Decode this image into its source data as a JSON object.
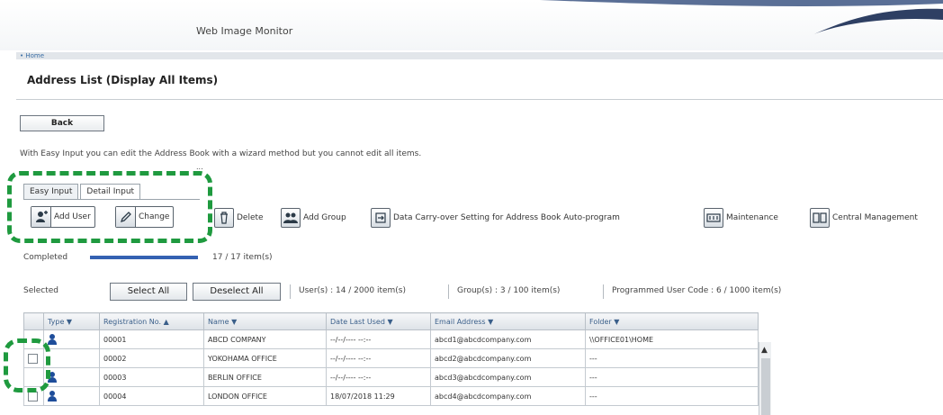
{
  "app": {
    "title": "Web Image Monitor"
  },
  "nav": {
    "home_link": "• Home"
  },
  "page": {
    "title": "Address List (Display All Items)"
  },
  "back_button": {
    "label": "Back"
  },
  "info": {
    "line1": "With Easy Input you can edit the Address Book with a wizard method but you cannot edit all items.",
    "line2": "..."
  },
  "tabs": [
    {
      "label": "Easy Input",
      "active": false
    },
    {
      "label": "Detail Input",
      "active": true
    }
  ],
  "toolbar": {
    "add_user": "Add User",
    "change": "Change",
    "delete": "Delete",
    "add_group": "Add Group",
    "data_carry_over": "Data Carry-over Setting for Address Book Auto-program",
    "maintenance": "Maintenance",
    "central_management": "Central Management"
  },
  "progress": {
    "label": "Completed",
    "fraction": 1.0,
    "count_text": "17 / 17 item(s)"
  },
  "selection": {
    "label": "Selected",
    "select_all": "Select All",
    "deselect_all": "Deselect All",
    "users_stat": "User(s) : 14 / 2000 item(s)",
    "groups_stat": "Group(s) : 3 / 100 item(s)",
    "user_code_stat": "Programmed User Code : 6 / 1000 item(s)"
  },
  "table": {
    "columns": [
      "Type ▼",
      "Registration No. ▲",
      "Name ▼",
      "Date Last Used ▼",
      "Email Address ▼",
      "Folder ▼"
    ],
    "rows": [
      {
        "reg": "00001",
        "name": "ABCD COMPANY",
        "date": "--/--/---- --:--",
        "email": "abcd1@abcdcompany.com",
        "folder": "\\\\OFFICE01\\HOME"
      },
      {
        "reg": "00002",
        "name": "YOKOHAMA OFFICE",
        "date": "--/--/---- --:--",
        "email": "abcd2@abcdcompany.com",
        "folder": "---"
      },
      {
        "reg": "00003",
        "name": "BERLIN OFFICE",
        "date": "--/--/---- --:--",
        "email": "abcd3@abcdcompany.com",
        "folder": "---"
      },
      {
        "reg": "00004",
        "name": "LONDON OFFICE",
        "date": "18/07/2018 11:29",
        "email": "abcd4@abcdcompany.com",
        "folder": "---"
      }
    ]
  },
  "colors": {
    "callout": "#1f9a3f",
    "progress": "#3461b2",
    "user_icon": "#1e4d9a"
  }
}
